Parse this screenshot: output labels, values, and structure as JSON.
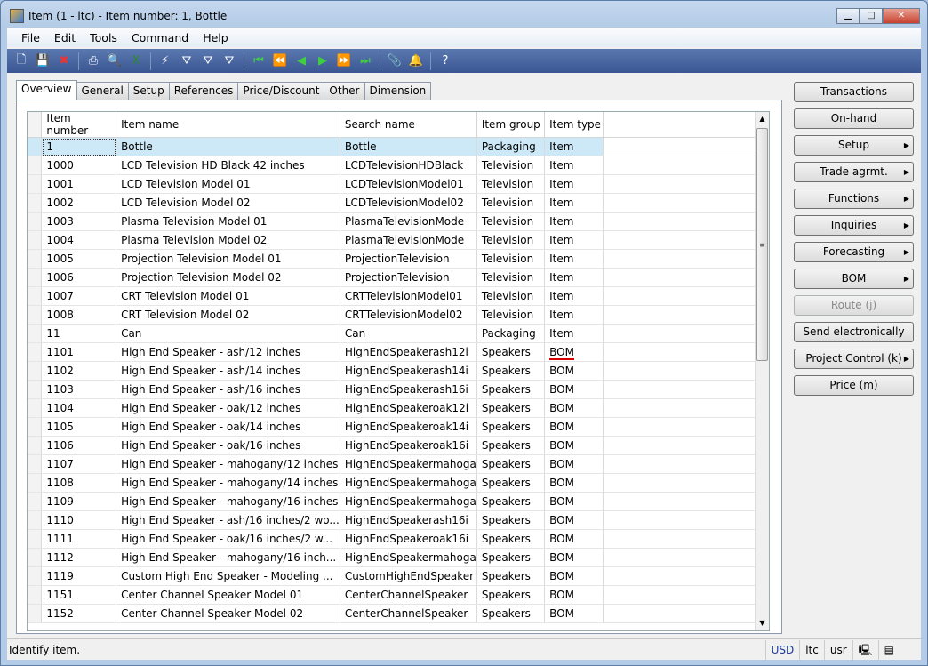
{
  "window": {
    "title": "Item (1 - ltc) - Item number: 1, Bottle"
  },
  "menu": [
    "File",
    "Edit",
    "Tools",
    "Command",
    "Help"
  ],
  "toolbar": [
    "new-icon",
    "save-icon",
    "delete-icon",
    "|",
    "print-icon",
    "print-preview-icon",
    "excel-icon",
    "|",
    "filter-by-selection-icon",
    "filter-by-grid-icon",
    "advanced-filter-icon",
    "remove-filter-icon",
    "|",
    "first-record-icon",
    "previous-page-icon",
    "previous-record-icon",
    "next-record-icon",
    "next-page-icon",
    "last-record-icon",
    "|",
    "document-handling-icon",
    "alert-icon",
    "|",
    "help-icon"
  ],
  "tabs": [
    "Overview",
    "General",
    "Setup",
    "References",
    "Price/Discount",
    "Other",
    "Dimension"
  ],
  "grid": {
    "columns": [
      "Item number",
      "Item name",
      "Search name",
      "Item group",
      "Item type"
    ],
    "rows": [
      [
        "1",
        "Bottle",
        "Bottle",
        "Packaging",
        "Item"
      ],
      [
        "1000",
        "LCD Television HD Black 42 inches",
        "LCDTelevisionHDBlack",
        "Television",
        "Item"
      ],
      [
        "1001",
        "LCD Television Model 01",
        "LCDTelevisionModel01",
        "Television",
        "Item"
      ],
      [
        "1002",
        "LCD Television Model 02",
        "LCDTelevisionModel02",
        "Television",
        "Item"
      ],
      [
        "1003",
        "Plasma Television Model 01",
        "PlasmaTelevisionMode",
        "Television",
        "Item"
      ],
      [
        "1004",
        "Plasma Television Model 02",
        "PlasmaTelevisionMode",
        "Television",
        "Item"
      ],
      [
        "1005",
        "Projection Television Model 01",
        "ProjectionTelevision",
        "Television",
        "Item"
      ],
      [
        "1006",
        "Projection Television Model 02",
        "ProjectionTelevision",
        "Television",
        "Item"
      ],
      [
        "1007",
        "CRT Television Model 01",
        "CRTTelevisionModel01",
        "Television",
        "Item"
      ],
      [
        "1008",
        "CRT Television Model 02",
        "CRTTelevisionModel02",
        "Television",
        "Item"
      ],
      [
        "11",
        "Can",
        "Can",
        "Packaging",
        "Item"
      ],
      [
        "1101",
        "High End Speaker - ash/12 inches",
        "HighEndSpeakerash12i",
        "Speakers",
        "BOM"
      ],
      [
        "1102",
        "High End Speaker - ash/14 inches",
        "HighEndSpeakerash14i",
        "Speakers",
        "BOM"
      ],
      [
        "1103",
        "High End Speaker - ash/16 inches",
        "HighEndSpeakerash16i",
        "Speakers",
        "BOM"
      ],
      [
        "1104",
        "High End Speaker - oak/12 inches",
        "HighEndSpeakeroak12i",
        "Speakers",
        "BOM"
      ],
      [
        "1105",
        "High End Speaker - oak/14 inches",
        "HighEndSpeakeroak14i",
        "Speakers",
        "BOM"
      ],
      [
        "1106",
        "High End Speaker - oak/16 inches",
        "HighEndSpeakeroak16i",
        "Speakers",
        "BOM"
      ],
      [
        "1107",
        "High End Speaker - mahogany/12 inches",
        "HighEndSpeakermahoga",
        "Speakers",
        "BOM"
      ],
      [
        "1108",
        "High End Speaker - mahogany/14 inches",
        "HighEndSpeakermahoga",
        "Speakers",
        "BOM"
      ],
      [
        "1109",
        "High End Speaker - mahogany/16 inches",
        "HighEndSpeakermahoga",
        "Speakers",
        "BOM"
      ],
      [
        "1110",
        "High End Speaker - ash/16 inches/2 wo...",
        "HighEndSpeakerash16i",
        "Speakers",
        "BOM"
      ],
      [
        "1111",
        "High End Speaker - oak/16 inches/2 w...",
        "HighEndSpeakeroak16i",
        "Speakers",
        "BOM"
      ],
      [
        "1112",
        "High End Speaker - mahogany/16 inch...",
        "HighEndSpeakermahoga",
        "Speakers",
        "BOM"
      ],
      [
        "1119",
        "Custom High End Speaker - Modeling ...",
        "CustomHighEndSpeaker",
        "Speakers",
        "BOM"
      ],
      [
        "1151",
        "Center Channel Speaker Model 01",
        "CenterChannelSpeaker",
        "Speakers",
        "BOM"
      ],
      [
        "1152",
        "Center Channel Speaker Model 02",
        "CenterChannelSpeaker",
        "Speakers",
        "BOM"
      ]
    ]
  },
  "buttons": [
    {
      "label": "Transactions",
      "menu": false,
      "enabled": true
    },
    {
      "label": "On-hand",
      "menu": false,
      "enabled": true
    },
    {
      "label": "Setup",
      "menu": true,
      "enabled": true
    },
    {
      "label": "Trade agrmt.",
      "menu": true,
      "enabled": true
    },
    {
      "label": "Functions",
      "menu": true,
      "enabled": true
    },
    {
      "label": "Inquiries",
      "menu": true,
      "enabled": true
    },
    {
      "label": "Forecasting",
      "menu": true,
      "enabled": true
    },
    {
      "label": "BOM",
      "menu": true,
      "enabled": true
    },
    {
      "label": "Route (j)",
      "menu": false,
      "enabled": false
    },
    {
      "label": "Send electronically",
      "menu": false,
      "enabled": true
    },
    {
      "label": "Project Control (k)",
      "menu": true,
      "enabled": true
    },
    {
      "label": "Price (m)",
      "menu": false,
      "enabled": true
    }
  ],
  "status": {
    "text": "Identify item.",
    "currency": "USD",
    "company": "ltc",
    "user": "usr"
  }
}
